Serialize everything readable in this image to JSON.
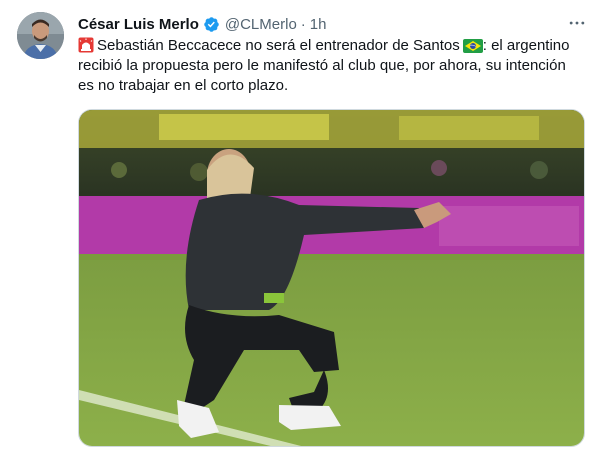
{
  "tweet": {
    "author": {
      "display_name": "César Luis Merlo",
      "handle": "@CLMerlo",
      "verified": true,
      "avatar_icon": "profile-photo"
    },
    "separator": "·",
    "time": "1h",
    "more_icon": "more-options-icon",
    "text_lines": [
      {
        "prefix_icon": "red-siren-emoji",
        "text": "Sebastián Beccacece no será el entrenador de Santos",
        "suffix_icon": "brazil-flag-emoji",
        "suffix_text": ": el argentino"
      },
      {
        "text": "recibió la propuesta pero le manifestó al club que, por ahora, su intención"
      },
      {
        "text": "es no trabajar en el corto plazo."
      }
    ],
    "media": {
      "type": "photo",
      "description_icon": "coach-photo"
    }
  },
  "colors": {
    "text_primary": "#0f1419",
    "text_secondary": "#536471",
    "verified_blue": "#1d9bf0",
    "border": "#cfd9de"
  }
}
